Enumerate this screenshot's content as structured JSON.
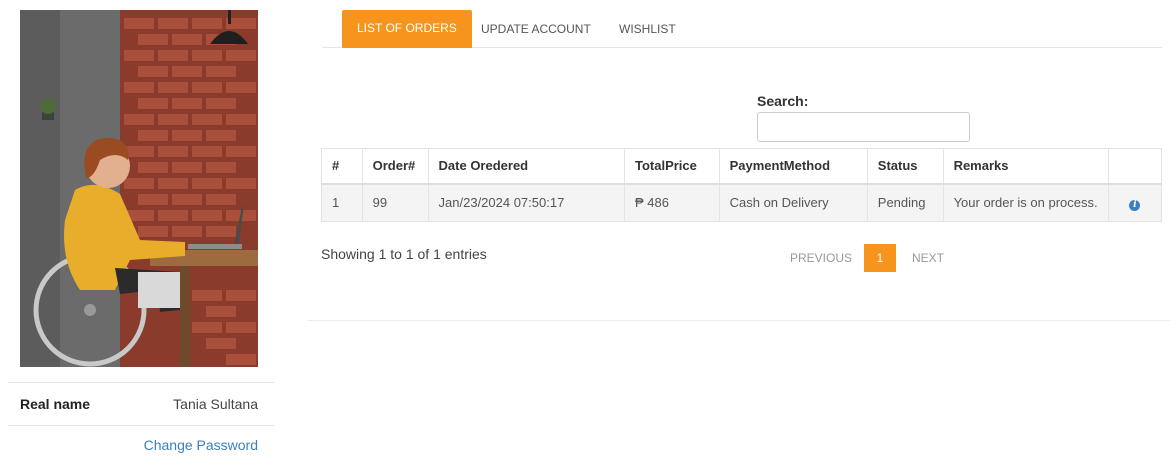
{
  "profile": {
    "real_name_label": "Real name",
    "real_name_value": "Tania Sultana",
    "change_password_label": "Change Password"
  },
  "tabs": [
    {
      "label": "LIST OF ORDERS",
      "active": true
    },
    {
      "label": "UPDATE ACCOUNT",
      "active": false
    },
    {
      "label": "WISHLIST",
      "active": false
    }
  ],
  "search": {
    "label": "Search:",
    "value": ""
  },
  "table": {
    "columns": [
      "#",
      "Order#",
      "Date Oredered",
      "TotalPrice",
      "PaymentMethod",
      "Status",
      "Remarks",
      ""
    ],
    "rows": [
      [
        "1",
        "99",
        "Jan/23/2024 07:50:17",
        "₱ 486",
        "Cash on Delivery",
        "Pending",
        "Your order is on process.",
        "info-icon"
      ]
    ]
  },
  "footer": {
    "entries_info": "Showing 1 to 1 of 1 entries",
    "previous_label": "PREVIOUS",
    "current_page": "1",
    "next_label": "NEXT"
  },
  "colors": {
    "accent": "#f7941d",
    "link": "#3a7fc1"
  }
}
